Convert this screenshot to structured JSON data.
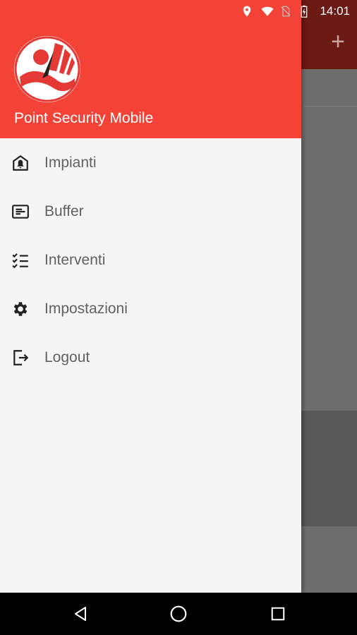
{
  "status_bar": {
    "time": "14:01",
    "icons": [
      "location-icon",
      "wifi-icon",
      "no-sim-icon",
      "battery-charging-icon"
    ]
  },
  "background": {
    "add_icon": "plus-icon",
    "toolbar_color": "#6b1a14"
  },
  "drawer": {
    "header_color": "#f44336",
    "app_name": "Point Security Mobile",
    "logo_icon": "point-security-logo",
    "items": [
      {
        "label": "Impianti",
        "icon": "building-alarm-icon"
      },
      {
        "label": "Buffer",
        "icon": "buffer-list-icon"
      },
      {
        "label": "Interventi",
        "icon": "checklist-icon"
      },
      {
        "label": "Impostazioni",
        "icon": "gear-icon"
      },
      {
        "label": "Logout",
        "icon": "logout-icon"
      }
    ]
  },
  "nav_bar": {
    "buttons": [
      "back-icon",
      "home-icon",
      "recents-icon"
    ]
  }
}
